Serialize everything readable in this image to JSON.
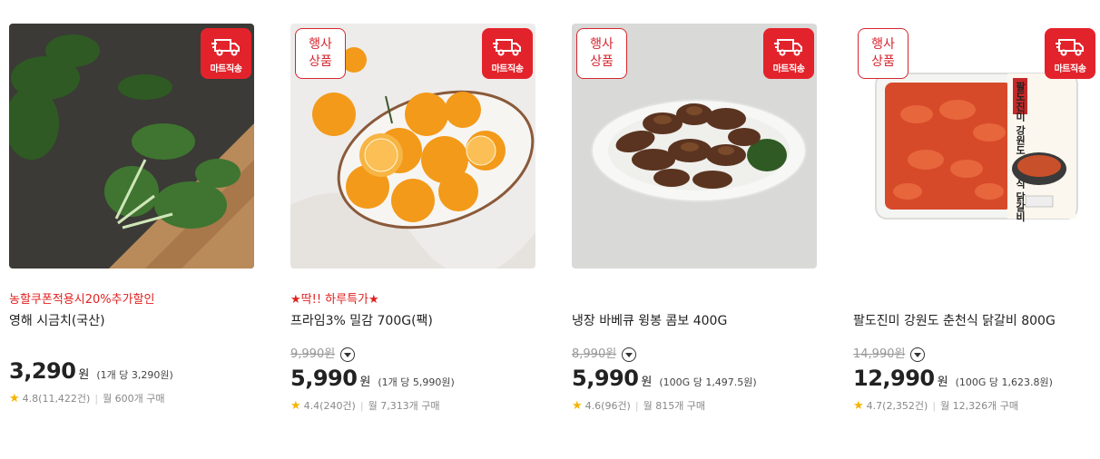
{
  "products": [
    {
      "event_badge": "",
      "direct_badge": "마트직송",
      "promo": "농할쿠폰적용시20%추가할인",
      "name": "영해 시금치(국산)",
      "original_price": "",
      "price": "3,290",
      "won": "원",
      "unit_price": "(1개 당 3,290원)",
      "rating": "4.8(11,422건)",
      "monthly": "월 600개 구매",
      "image": "spinach-photo"
    },
    {
      "event_badge": "행사\n상품",
      "direct_badge": "마트직송",
      "promo": "★딱!! 하루특가★",
      "name": "프라임3% 밀감 700G(팩)",
      "original_price": "9,990원",
      "price": "5,990",
      "won": "원",
      "unit_price": "(1개 당 5,990원)",
      "rating": "4.4(240건)",
      "monthly": "월 7,313개 구매",
      "image": "tangerine-photo"
    },
    {
      "event_badge": "행사\n상품",
      "direct_badge": "마트직송",
      "promo": "",
      "name": "냉장 바베큐 윙봉 콤보 400G",
      "original_price": "8,990원",
      "price": "5,990",
      "won": "원",
      "unit_price": "(100G 당 1,497.5원)",
      "rating": "4.6(96건)",
      "monthly": "월 815개 구매",
      "image": "chicken-wings-photo"
    },
    {
      "event_badge": "행사\n상품",
      "direct_badge": "마트직송",
      "promo": "",
      "name": "팔도진미 강원도 춘천식 닭갈비 800G",
      "original_price": "14,990원",
      "price": "12,990",
      "won": "원",
      "unit_price": "(100G 당 1,623.8원)",
      "rating": "4.7(2,352건)",
      "monthly": "월 12,326개 구매",
      "image": "dakgalbi-package-photo",
      "package_text": "팔도진미 강원도 춘천식 닭갈비"
    }
  ],
  "colors": {
    "accent": "#e3232c",
    "promo": "#e02020",
    "star": "#f5b400"
  }
}
